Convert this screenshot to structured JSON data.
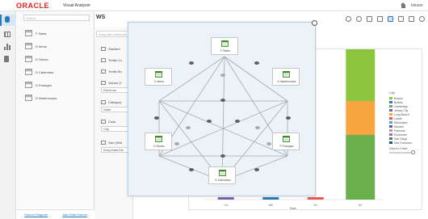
{
  "header": {
    "brand": "ORACLE",
    "product": "Visual Analyzer",
    "user": "tstuser"
  },
  "search": {
    "placeholder": "Search"
  },
  "data_sources": [
    {
      "label": "F Sales"
    },
    {
      "label": "D Items"
    },
    {
      "label": "D Stores"
    },
    {
      "label": "D Calendars"
    },
    {
      "label": "D Emarges"
    },
    {
      "label": "D Warehouses"
    }
  ],
  "panel_footer": {
    "source_diagram": "Source Diagram",
    "add_data_source": "Add Data Source"
  },
  "toolbar": {
    "title": "WS"
  },
  "center_panel": {
    "search_placeholder": "Drag data elements",
    "rows": [
      "Stacked",
      "Trellis Co",
      "Trellis Ro",
      "Values (Y"
    ],
    "values_field": "Revenue",
    "category_label": "Category",
    "category_field": "State",
    "color_label": "Color",
    "color_field": "City",
    "size_label": "Size (Wid",
    "size_field": "Drag Data Ele"
  },
  "schema_nodes": [
    {
      "id": "sales",
      "label": "F Sales"
    },
    {
      "id": "items",
      "label": "D Items"
    },
    {
      "id": "warehouses",
      "label": "D Warehouses"
    },
    {
      "id": "stores",
      "label": "D Stores"
    },
    {
      "id": "emarges",
      "label": "F Emarges"
    },
    {
      "id": "calendars",
      "label": "D Calendars"
    }
  ],
  "legend": {
    "title": "City",
    "items": [
      {
        "label": "Boston",
        "color": "#8dc63f"
      },
      {
        "label": "Buffalo",
        "color": "#2a7ab8"
      },
      {
        "label": "Cambridge",
        "color": "#6ab04c"
      },
      {
        "label": "Jersey City",
        "color": "#7b61a8"
      },
      {
        "label": "Long Beach",
        "color": "#f7a540"
      },
      {
        "label": "Lowell",
        "color": "#e85a4f"
      },
      {
        "label": "Manhattan",
        "color": "#3db0d0"
      },
      {
        "label": "Newark",
        "color": "#5a5ab0"
      },
      {
        "label": "Paterson",
        "color": "#a0a0a0"
      },
      {
        "label": "Rochester",
        "color": "#b55bb0"
      },
      {
        "label": "San Diego",
        "color": "#3b8a5a"
      },
      {
        "label": "San Francisco",
        "color": "#1f4e8c"
      }
    ],
    "slider_label": "Data for Entire"
  },
  "chart_data": {
    "type": "bar",
    "categories": [
      "CA",
      "MA",
      "NJ",
      "NY"
    ],
    "xlabel": "State",
    "visible_segments": [
      {
        "category": "NY",
        "color": "#8dc63f"
      },
      {
        "category": "NY",
        "color": "#f7a540"
      },
      {
        "category": "NY",
        "color": "#6ab04c"
      }
    ]
  }
}
